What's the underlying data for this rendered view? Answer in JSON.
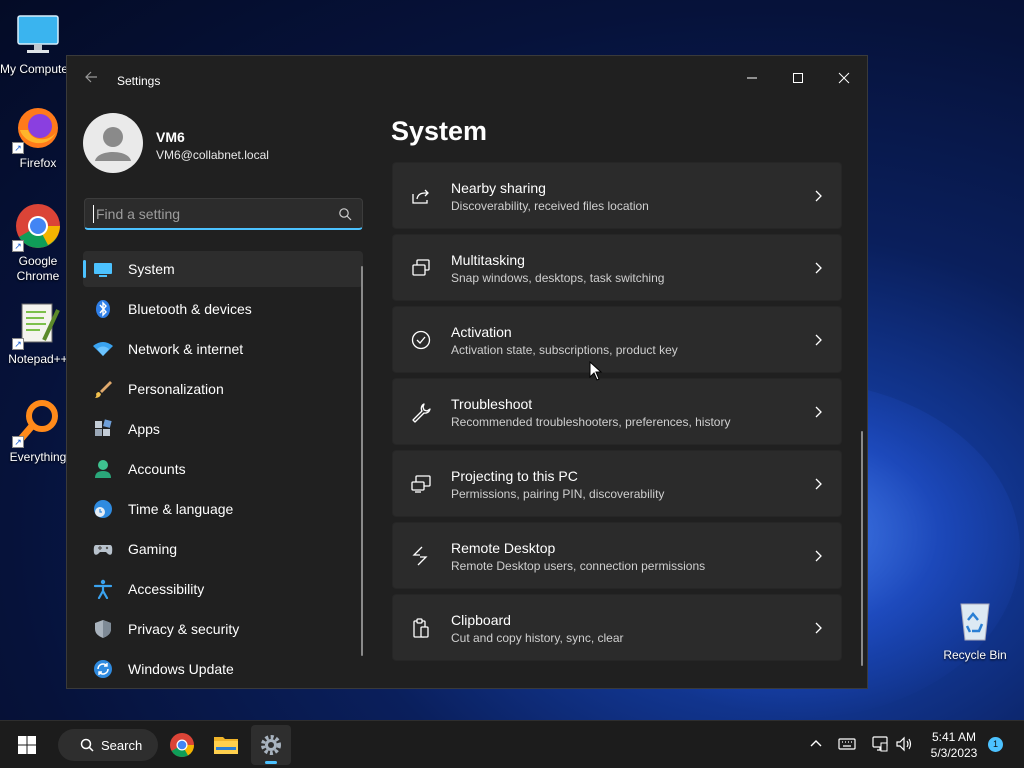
{
  "desktop": {
    "icons": [
      {
        "label": "My Computer"
      },
      {
        "label": "Firefox"
      },
      {
        "label": "Google Chrome"
      },
      {
        "label": "Notepad++"
      },
      {
        "label": "Everything"
      },
      {
        "label": "Recycle Bin"
      }
    ]
  },
  "window": {
    "title": "Settings",
    "profile": {
      "name": "VM6",
      "email": "VM6@collabnet.local"
    },
    "search": {
      "placeholder": "Find a setting"
    },
    "nav": [
      {
        "label": "System",
        "icon": "system-icon",
        "active": true
      },
      {
        "label": "Bluetooth & devices",
        "icon": "bluetooth-icon"
      },
      {
        "label": "Network & internet",
        "icon": "wifi-icon"
      },
      {
        "label": "Personalization",
        "icon": "paintbrush-icon"
      },
      {
        "label": "Apps",
        "icon": "apps-icon"
      },
      {
        "label": "Accounts",
        "icon": "person-icon"
      },
      {
        "label": "Time & language",
        "icon": "globe-clock-icon"
      },
      {
        "label": "Gaming",
        "icon": "gamepad-icon"
      },
      {
        "label": "Accessibility",
        "icon": "accessibility-icon"
      },
      {
        "label": "Privacy & security",
        "icon": "shield-icon"
      },
      {
        "label": "Windows Update",
        "icon": "update-icon"
      }
    ],
    "page_title": "System",
    "cards": [
      {
        "title": "Nearby sharing",
        "subtitle": "Discoverability, received files location",
        "icon": "share-icon"
      },
      {
        "title": "Multitasking",
        "subtitle": "Snap windows, desktops, task switching",
        "icon": "multitasking-icon"
      },
      {
        "title": "Activation",
        "subtitle": "Activation state, subscriptions, product key",
        "icon": "check-circle-icon"
      },
      {
        "title": "Troubleshoot",
        "subtitle": "Recommended troubleshooters, preferences, history",
        "icon": "wrench-icon"
      },
      {
        "title": "Projecting to this PC",
        "subtitle": "Permissions, pairing PIN, discoverability",
        "icon": "projector-icon"
      },
      {
        "title": "Remote Desktop",
        "subtitle": "Remote Desktop users, connection permissions",
        "icon": "remote-desktop-icon"
      },
      {
        "title": "Clipboard",
        "subtitle": "Cut and copy history, sync, clear",
        "icon": "clipboard-icon"
      }
    ]
  },
  "taskbar": {
    "search_label": "Search",
    "time": "5:41 AM",
    "date": "5/3/2023",
    "notification_count": "1"
  }
}
